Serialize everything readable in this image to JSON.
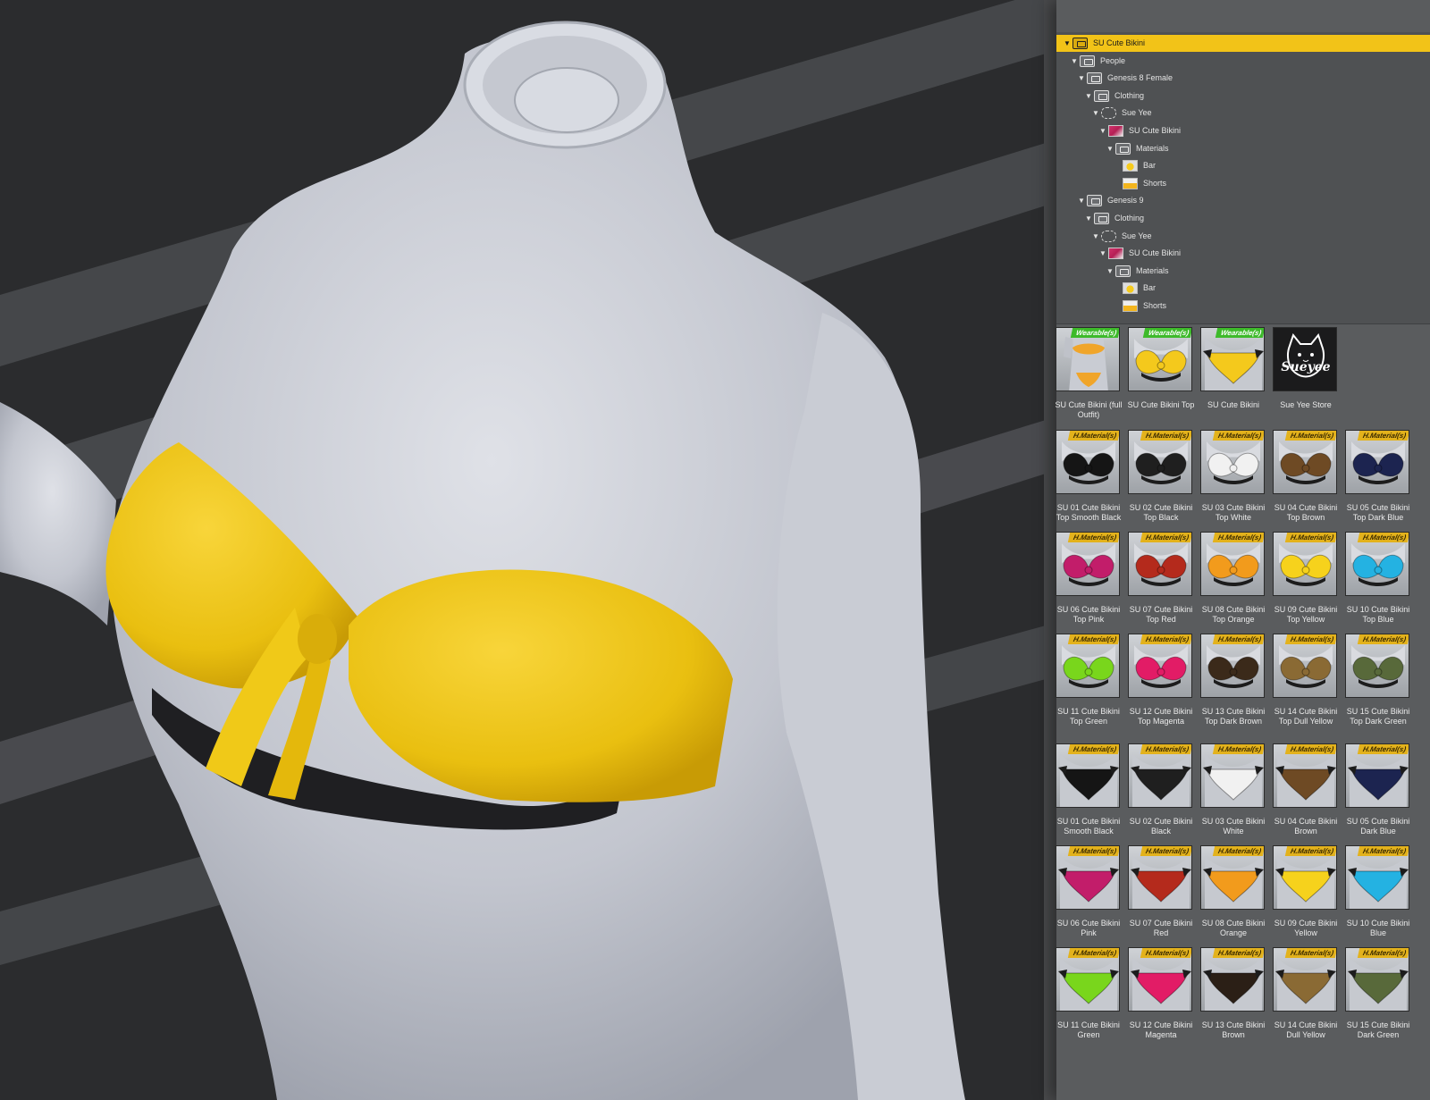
{
  "colors": {
    "selection": "#f2c318",
    "panel_bg": "#5a5c5e",
    "tree_bg": "#4f5153",
    "wearable_tag": "#3dba2a",
    "material_tag": "#e3b21c",
    "viewport_bg": "#2c2d2f"
  },
  "tree": [
    {
      "label": "SU Cute Bikini",
      "icon": "folder-icon",
      "depth": 0,
      "selected": true
    },
    {
      "label": "People",
      "icon": "folder-icon",
      "depth": 1
    },
    {
      "label": "Genesis 8 Female",
      "icon": "folder-icon",
      "depth": 2
    },
    {
      "label": "Clothing",
      "icon": "folder-icon",
      "depth": 3
    },
    {
      "label": "Sue Yee",
      "icon": "vendor-icon",
      "depth": 4
    },
    {
      "label": "SU Cute Bikini",
      "icon": "product-thumb-icon",
      "depth": 5
    },
    {
      "label": "Materials",
      "icon": "folder-icon",
      "depth": 6
    },
    {
      "label": "Bar",
      "icon": "bar-thumb-icon",
      "depth": 7,
      "leaf": true
    },
    {
      "label": "Shorts",
      "icon": "shorts-thumb-icon",
      "depth": 7,
      "leaf": true
    },
    {
      "label": "Genesis 9",
      "icon": "folder-icon",
      "depth": 2
    },
    {
      "label": "Clothing",
      "icon": "folder-icon",
      "depth": 3
    },
    {
      "label": "Sue Yee",
      "icon": "vendor-icon",
      "depth": 4
    },
    {
      "label": "SU Cute Bikini",
      "icon": "product-thumb-icon",
      "depth": 5
    },
    {
      "label": "Materials",
      "icon": "folder-icon",
      "depth": 6
    },
    {
      "label": "Bar",
      "icon": "bar-thumb-icon",
      "depth": 7,
      "leaf": true
    },
    {
      "label": "Shorts",
      "icon": "shorts-thumb-icon",
      "depth": 7,
      "leaf": true
    }
  ],
  "wearables": [
    {
      "label": "SU Cute Bikini (full Outfit)",
      "tag": "Wearable(s)",
      "kind": "outfit",
      "color": "#f0a52a"
    },
    {
      "label": "SU Cute Bikini Top",
      "tag": "Wearable(s)",
      "kind": "top",
      "color": "#f4c91c"
    },
    {
      "label": "SU Cute Bikini",
      "tag": "Wearable(s)",
      "kind": "bottom",
      "color": "#f4c91c"
    },
    {
      "label": "Sue Yee Store",
      "tag": "",
      "kind": "logo",
      "color": "#1b1b1c",
      "logo_text": "Sueyee"
    }
  ],
  "material_tag": "H.Material(s)",
  "materials_top": [
    {
      "label": "SU 01 Cute Bikini Top Smooth Black",
      "color": "#151515"
    },
    {
      "label": "SU 02 Cute Bikini Top Black",
      "color": "#1f1f1f"
    },
    {
      "label": "SU 03 Cute Bikini Top White",
      "color": "#f1f1f1"
    },
    {
      "label": "SU 04 Cute Bikini Top Brown",
      "color": "#6e4a24"
    },
    {
      "label": "SU 05 Cute Bikini Top Dark Blue",
      "color": "#1c2450"
    },
    {
      "label": "SU 06 Cute Bikini Top Pink",
      "color": "#c21d6a"
    },
    {
      "label": "SU 07 Cute Bikini Top Red",
      "color": "#b42a1c"
    },
    {
      "label": "SU 08 Cute Bikini Top Orange",
      "color": "#f29b1c"
    },
    {
      "label": "SU 09 Cute Bikini Top Yellow",
      "color": "#f6d21c"
    },
    {
      "label": "SU 10 Cute Bikini Top Blue",
      "color": "#24b2e2"
    },
    {
      "label": "SU 11 Cute Bikini Top Green",
      "color": "#79d61c"
    },
    {
      "label": "SU 12 Cute Bikini Top Magenta",
      "color": "#e21c66"
    },
    {
      "label": "SU 13 Cute Bikini Top Dark Brown",
      "color": "#3b2a1a"
    },
    {
      "label": "SU 14 Cute Bikini Top Dull Yellow",
      "color": "#8a6a34"
    },
    {
      "label": "SU 15 Cute Bikini Top Dark Green",
      "color": "#58693a"
    }
  ],
  "materials_bottom": [
    {
      "label": "SU 01 Cute Bikini Smooth Black",
      "color": "#151515"
    },
    {
      "label": "SU 02 Cute Bikini Black",
      "color": "#1f1f1f"
    },
    {
      "label": "SU 03 Cute Bikini White",
      "color": "#f1f1f1"
    },
    {
      "label": "SU 04 Cute Bikini Brown",
      "color": "#6e4a24"
    },
    {
      "label": "SU 05 Cute Bikini Dark Blue",
      "color": "#1c2450"
    },
    {
      "label": "SU 06 Cute Bikini Pink",
      "color": "#c21d6a"
    },
    {
      "label": "SU 07 Cute Bikini Red",
      "color": "#b42a1c"
    },
    {
      "label": "SU 08 Cute Bikini Orange",
      "color": "#f29b1c"
    },
    {
      "label": "SU 09 Cute Bikini Yellow",
      "color": "#f6d21c"
    },
    {
      "label": "SU 10 Cute Bikini Blue",
      "color": "#24b2e2"
    },
    {
      "label": "SU 11 Cute Bikini Green",
      "color": "#79d61c"
    },
    {
      "label": "SU 12 Cute Bikini Magenta",
      "color": "#e21c66"
    },
    {
      "label": "SU 13 Cute Bikini Brown",
      "color": "#2b1f16"
    },
    {
      "label": "SU 14 Cute Bikini Dull Yellow",
      "color": "#8a6a34"
    },
    {
      "label": "SU 15 Cute Bikini Dark Green",
      "color": "#58693a"
    }
  ]
}
